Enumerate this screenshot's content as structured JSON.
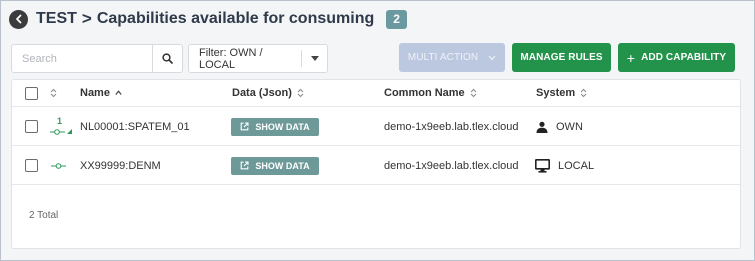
{
  "header": {
    "back_icon": "arrow-left-icon",
    "root": "TEST",
    "separator": ">",
    "title": "Capabilities available for consuming",
    "count": "2"
  },
  "toolbar": {
    "search_placeholder": "Search",
    "search_value": "",
    "filter_label": "Filter: OWN / LOCAL",
    "multi_action_label": "MULTI ACTION",
    "manage_rules_label": "MANAGE RULES",
    "add_capability_label": "ADD CAPABILITY",
    "add_capability_prefix": "+"
  },
  "table": {
    "columns": [
      "Name",
      "Data (Json)",
      "Common Name",
      "System"
    ],
    "rows": [
      {
        "status_count": "1",
        "name": "NL00001:SPATEM_01",
        "data_button": "SHOW DATA",
        "common_name": "demo-1x9eeb.lab.tlex.cloud",
        "system": "OWN",
        "system_icon": "person-icon"
      },
      {
        "status_count": "",
        "name": "XX99999:DENM",
        "data_button": "SHOW DATA",
        "common_name": "demo-1x9eeb.lab.tlex.cloud",
        "system": "LOCAL",
        "system_icon": "monitor-icon"
      }
    ],
    "total": "2 Total"
  },
  "colors": {
    "primary_green": "#23924a",
    "teal_badge": "#6a9aa0",
    "show_data": "#6d9a99",
    "disabled_button": "#bcc8df",
    "status_green": "#2e9a5a"
  }
}
